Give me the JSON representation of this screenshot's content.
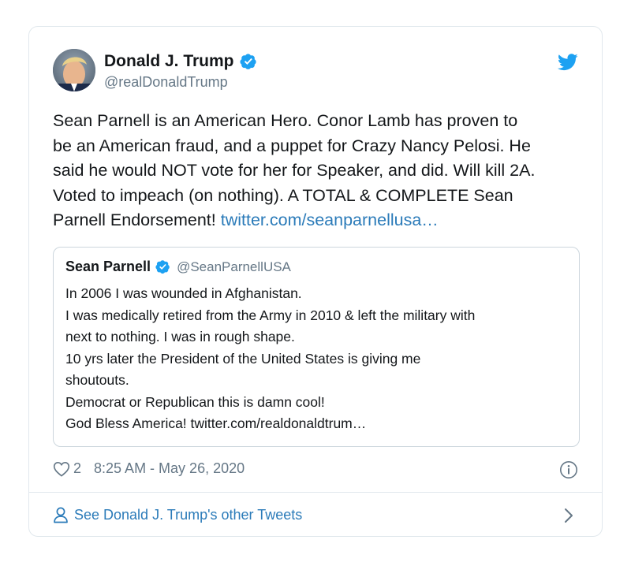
{
  "tweet": {
    "author": {
      "display_name": "Donald J. Trump",
      "handle": "@realDonaldTrump",
      "verified": true,
      "avatar_icon": "user-avatar-photo"
    },
    "text_lines": [
      "Sean Parnell is an American Hero. Conor Lamb has proven to",
      "be an American fraud, and a puppet for Crazy Nancy Pelosi. He",
      "said he would NOT vote for her for Speaker, and did. Will kill 2A.",
      "Voted to impeach (on nothing). A TOTAL & COMPLETE Sean",
      "Parnell Endorsement! "
    ],
    "link_text": "twitter.com/seanparnellusa…",
    "quoted": {
      "display_name": "Sean Parnell",
      "handle": "@SeanParnellUSA",
      "verified": true,
      "lines": [
        "In 2006 I was wounded in Afghanistan.",
        "I was medically retired from the Army in 2010 & left the military with",
        "next to nothing. I was in rough shape.",
        "10 yrs later the President of the United States is giving me",
        "shoutouts.",
        "Democrat or Republican this is damn cool!",
        "God Bless America! twitter.com/realdonaldtrum…"
      ]
    },
    "like_count": "2",
    "timestamp": "8:25 AM - May 26, 2020",
    "footer_text": "See Donald J. Trump's other Tweets",
    "icons": {
      "logo": "twitter-bird-icon",
      "verified": "verified-badge-icon",
      "like": "heart-icon",
      "info": "info-icon",
      "profile": "person-icon",
      "chevron": "chevron-right-icon"
    },
    "colors": {
      "brand_blue": "#1da1f2",
      "link_blue": "#2b7bb9",
      "secondary_text": "#657786",
      "border": "#e1e8ed"
    }
  }
}
